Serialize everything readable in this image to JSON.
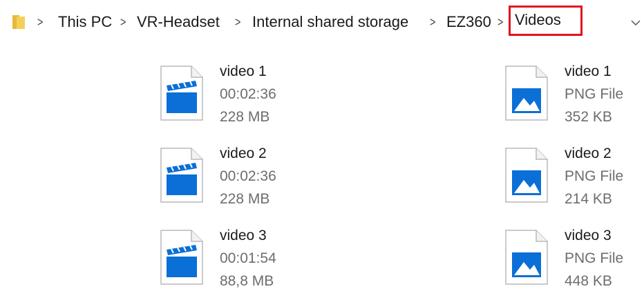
{
  "breadcrumb": {
    "items": [
      {
        "label": "This PC"
      },
      {
        "label": "VR-Headset"
      },
      {
        "label": "Internal shared storage"
      },
      {
        "label": "EZ360"
      },
      {
        "label": "Videos"
      }
    ]
  },
  "colors": {
    "highlight": "#e0141e",
    "icon_blue": "#0a6fd6",
    "secondary_text": "#6d6d6d"
  },
  "files": [
    {
      "name": "video 1",
      "meta1": "00:02:36",
      "meta2": "228 MB",
      "icon": "video-file-icon"
    },
    {
      "name": "video 2",
      "meta1": "00:02:36",
      "meta2": "228 MB",
      "icon": "video-file-icon"
    },
    {
      "name": "video 3",
      "meta1": "00:01:54",
      "meta2": "88,8 MB",
      "icon": "video-file-icon"
    },
    {
      "name": "video 1",
      "meta1": "PNG File",
      "meta2": "352 KB",
      "icon": "image-file-icon"
    },
    {
      "name": "video 2",
      "meta1": "PNG File",
      "meta2": "214 KB",
      "icon": "image-file-icon"
    },
    {
      "name": "video 3",
      "meta1": "PNG File",
      "meta2": "448 KB",
      "icon": "image-file-icon"
    }
  ]
}
